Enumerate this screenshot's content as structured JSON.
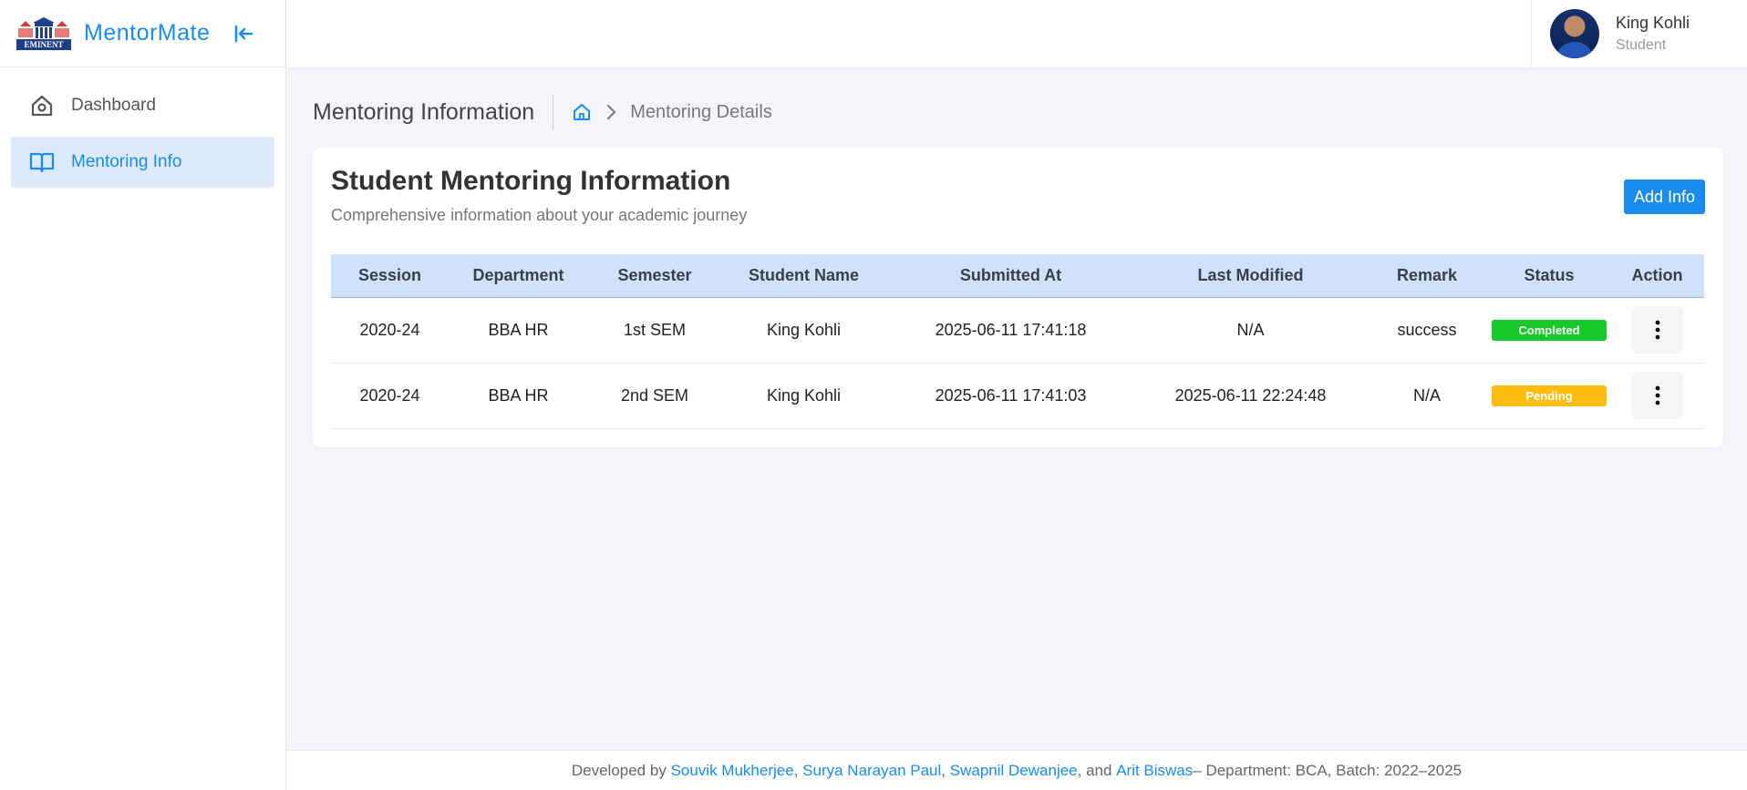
{
  "brand": {
    "name": "MentorMate",
    "logo_text": "EMINENT"
  },
  "sidebar": {
    "items": [
      {
        "label": "Dashboard",
        "icon": "home-icon",
        "active": false
      },
      {
        "label": "Mentoring Info",
        "icon": "book-icon",
        "active": true
      }
    ]
  },
  "user": {
    "name": "King Kohli",
    "role": "Student"
  },
  "breadcrumb": {
    "page_title": "Mentoring Information",
    "current": "Mentoring Details"
  },
  "card": {
    "title": "Student Mentoring Information",
    "subtitle": "Comprehensive information about your academic journey",
    "add_button": "Add Info"
  },
  "table": {
    "headers": [
      "Session",
      "Department",
      "Semester",
      "Student Name",
      "Submitted At",
      "Last Modified",
      "Remark",
      "Status",
      "Action"
    ],
    "rows": [
      {
        "session": "2020-24",
        "department": "BBA HR",
        "semester": "1st SEM",
        "student": "King Kohli",
        "submitted": "2025-06-11 17:41:18",
        "modified": "N/A",
        "remark": "success",
        "status": "Completed",
        "status_color": "#17c92a"
      },
      {
        "session": "2020-24",
        "department": "BBA HR",
        "semester": "2nd SEM",
        "student": "King Kohli",
        "submitted": "2025-06-11 17:41:03",
        "modified": "2025-06-11 22:24:48",
        "remark": "N/A",
        "status": "Pending",
        "status_color": "#fdbd0f"
      }
    ]
  },
  "footer": {
    "prefix": "Developed by ",
    "dev1": "Souvik Mukherjee",
    "sep1": ", ",
    "dev2": "Surya Narayan Paul",
    "sep2": ", ",
    "dev3": "Swapnil Dewanjee",
    "sep3": ", and ",
    "dev4": "Arit Biswas",
    "suffix": " – Department: BCA, Batch: 2022–2025"
  },
  "colors": {
    "accent": "#1a8cf0",
    "completed": "#17c92a",
    "pending": "#fdbd0f",
    "table_header": "#cfe1fb"
  }
}
